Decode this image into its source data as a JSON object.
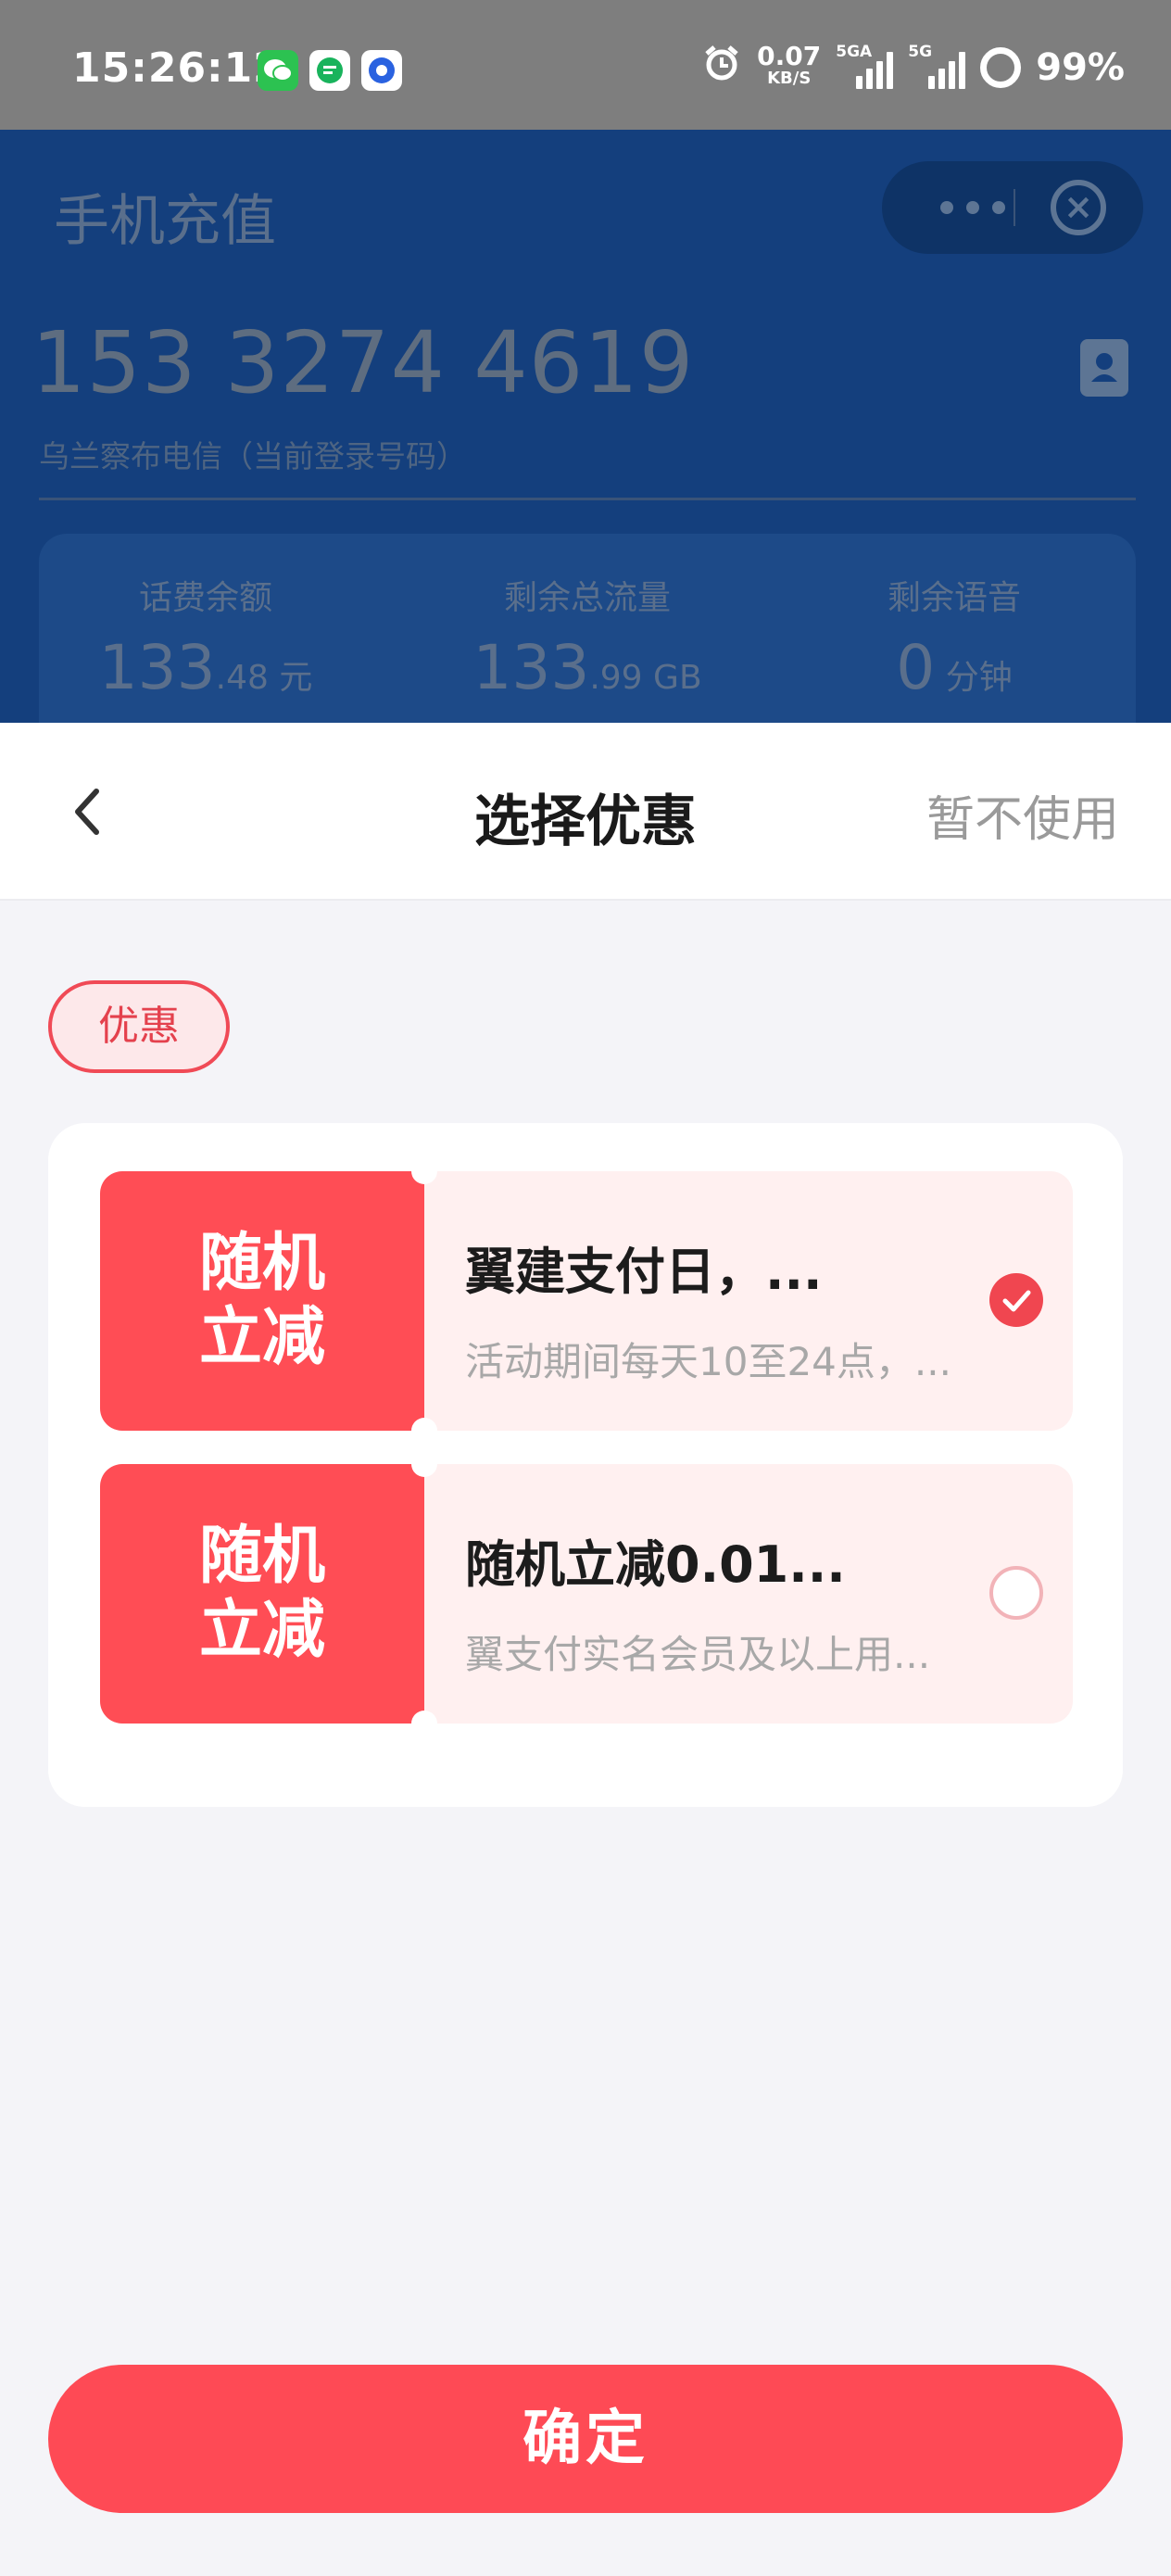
{
  "status_bar": {
    "time": "15:26:12",
    "speed_value": "0.07",
    "speed_unit": "KB/S",
    "sim1_label": "5GA",
    "sim2_label": "5G",
    "battery": "99%"
  },
  "background_page": {
    "title": "手机充值",
    "phone": "153 3274 4619",
    "subtitle": "乌兰察布电信（当前登录号码）",
    "stats": [
      {
        "label": "话费余额",
        "value": "133",
        "decimal": ".48",
        "unit": "元"
      },
      {
        "label": "剩余总流量",
        "value": "133",
        "decimal": ".99",
        "unit": "GB"
      },
      {
        "label": "剩余语音",
        "value": "0",
        "decimal": "",
        "unit": "分钟"
      }
    ]
  },
  "sheet": {
    "title": "选择优惠",
    "skip_label": "暂不使用",
    "section_chip": "优惠",
    "coupons": [
      {
        "tag_line1": "随机",
        "tag_line2": "立减",
        "title": "翼建支付日，...",
        "desc": "活动期间每天10至24点，...",
        "selected": true
      },
      {
        "tag_line1": "随机",
        "tag_line2": "立减",
        "title": "随机立减0.01...",
        "desc": "翼支付实名会员及以上用...",
        "selected": false
      }
    ],
    "confirm_label": "确定"
  },
  "colors": {
    "accent": "#fe4a55",
    "coupon_tag": "#ff4d55",
    "coupon_body": "#fff0f0",
    "dim_page": "#143f7d"
  },
  "icons": [
    "wechat-icon",
    "message-icon",
    "app-icon",
    "alarm-icon",
    "signal-icon",
    "battery-icon",
    "more-icon",
    "close-icon",
    "contact-icon",
    "back-arrow-icon",
    "check-icon"
  ]
}
